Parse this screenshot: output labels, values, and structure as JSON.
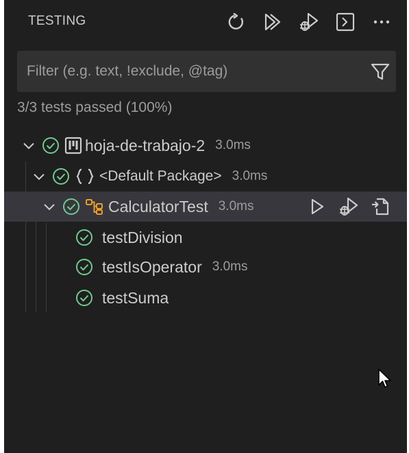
{
  "header": {
    "title": "TESTING",
    "toolbar": [
      {
        "name": "refresh-tests",
        "icon": "refresh-icon"
      },
      {
        "name": "run-all-tests",
        "icon": "run-all-icon"
      },
      {
        "name": "debug-all-tests",
        "icon": "debug-icon"
      },
      {
        "name": "show-output",
        "icon": "terminal-output-icon"
      },
      {
        "name": "more-actions",
        "icon": "ellipsis-icon"
      }
    ]
  },
  "filter": {
    "placeholder": "Filter (e.g. text, !exclude, @tag)",
    "value": "",
    "icon": "filter-icon"
  },
  "summary": "3/3 tests passed (100%)",
  "tree": [
    {
      "label": "hoja-de-trabajo-2",
      "duration": "3.0ms",
      "status": "passed",
      "kind": "project",
      "expanded": true,
      "level": 0
    },
    {
      "label": "<Default Package>",
      "duration": "3.0ms",
      "status": "passed",
      "kind": "package",
      "expanded": true,
      "level": 1
    },
    {
      "label": "CalculatorTest",
      "duration": "3.0ms",
      "status": "passed",
      "kind": "class",
      "expanded": true,
      "level": 2,
      "selected": true
    },
    {
      "label": "testDivision",
      "duration": "",
      "status": "passed",
      "kind": "method",
      "level": 3
    },
    {
      "label": "testIsOperator",
      "duration": "3.0ms",
      "status": "passed",
      "kind": "method",
      "level": 3
    },
    {
      "label": "testSuma",
      "duration": "",
      "status": "passed",
      "kind": "method",
      "level": 3
    }
  ],
  "row_actions": [
    {
      "name": "run-test",
      "icon": "run-icon"
    },
    {
      "name": "debug-test",
      "icon": "debug-icon"
    },
    {
      "name": "go-to-test",
      "icon": "go-to-file-icon"
    }
  ],
  "colors": {
    "panel_bg": "#1f1f1f",
    "filter_bg": "#313131",
    "selected_row_bg": "#37373d",
    "passed_green": "#73c991",
    "class_orange": "#ee9d28",
    "text": "#cccccc",
    "muted_text": "#9d9d9d"
  }
}
